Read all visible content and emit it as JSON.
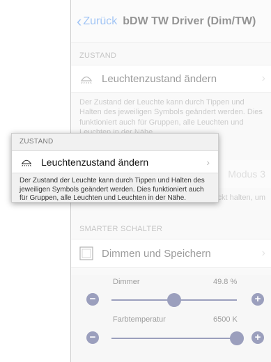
{
  "nav": {
    "back_label": "Zurück",
    "title": "bDW TW Driver (Dim/TW)"
  },
  "zustand": {
    "header": "ZUSTAND",
    "row_label": "Leuchtenzustand ändern",
    "footer": "Der Zustand der Leuchte kann durch Tippen und Halten des jeweiligen Symbols geändert werden. Dies funktioniert auch für Gruppen, alle Leuchten und Leuchten in der Nähe."
  },
  "modus": {
    "value": "Modus 3",
    "footer_fragment": "ckt halten, um"
  },
  "smarter_schalter": {
    "header": "SMARTER SCHALTER",
    "row_label": "Dimmen und Speichern"
  },
  "sliders": [
    {
      "label": "Dimmer",
      "value_text": "49.8 %",
      "level": 0.498
    },
    {
      "label": "Farbtemperatur",
      "value_text": "6500 K",
      "level": 1.0
    }
  ],
  "popup": {
    "header": "ZUSTAND",
    "row_label": "Leuchtenzustand ändern",
    "footer": "Der Zustand der Leuchte kann durch Tippen und Halten des jeweiligen Symbols geändert werden. Dies funktioniert auch für Gruppen, alle Leuchten und Leuchten in der Nähe."
  },
  "icons": {
    "back": "chevron-left-icon",
    "lamp": "ceiling-lamp-icon",
    "checkbox": "square-icon",
    "chevron": "chevron-right-icon",
    "minus": "minus-icon",
    "plus": "plus-icon"
  },
  "colors": {
    "accent": "#2f7ee8",
    "slider": "#232c6e"
  }
}
